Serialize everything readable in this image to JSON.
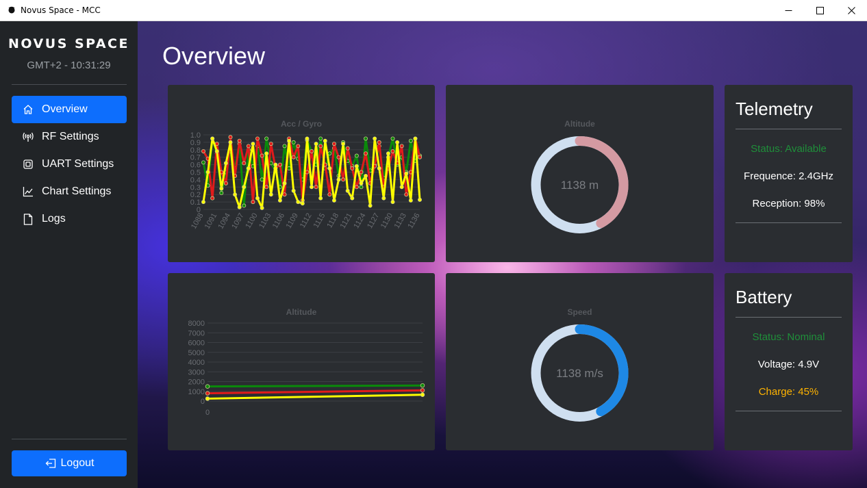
{
  "window": {
    "title": "Novus Space - MCC"
  },
  "sidebar": {
    "brand": "NOVUS SPACE",
    "clock": "GMT+2 - 10:31:29",
    "items": [
      {
        "label": "Overview",
        "icon": "home-icon",
        "active": true
      },
      {
        "label": "RF Settings",
        "icon": "antenna-icon",
        "active": false
      },
      {
        "label": "UART Settings",
        "icon": "chip-icon",
        "active": false
      },
      {
        "label": "Chart Settings",
        "icon": "graph-icon",
        "active": false
      },
      {
        "label": "Logs",
        "icon": "file-icon",
        "active": false
      }
    ],
    "logout_label": "Logout"
  },
  "main": {
    "title": "Overview"
  },
  "telemetry": {
    "heading": "Telemetry",
    "status": "Status: Available",
    "frequence": "Frequence: 2.4GHz",
    "reception": "Reception: 98%"
  },
  "battery": {
    "heading": "Battery",
    "status": "Status: Nominal",
    "voltage": "Voltage: 4.9V",
    "charge": "Charge: 45%"
  },
  "colors": {
    "accent": "#0d6efd",
    "status_ok": "#1f8f3a",
    "warning": "#ffb300",
    "series_green": "#0a8a0a",
    "series_red": "#e01b1b",
    "series_yellow": "#ffff00"
  },
  "chart_data": [
    {
      "type": "line",
      "title": "Acc / Gyro",
      "x_tick_labels": [
        "1088",
        "1091",
        "1094",
        "1097",
        "1100",
        "1103",
        "1106",
        "1109",
        "1112",
        "1115",
        "1118",
        "1121",
        "1124",
        "1127",
        "1130",
        "1133",
        "1136"
      ],
      "ylim": [
        0,
        1
      ],
      "y_ticks": [
        "0",
        "0.1",
        "0.2",
        "0.3",
        "0.4",
        "0.5",
        "0.6",
        "0.7",
        "0.8",
        "0.9",
        "1.0"
      ],
      "series": [
        {
          "color": "#0a8a0a",
          "values": [
            0.63,
            0.32,
            0.95,
            0.75,
            0.22,
            0.5,
            0.78,
            0.55,
            0.88,
            0.05,
            0.8,
            0.58,
            0.85,
            0.4,
            0.95,
            0.62,
            0.52,
            0.3,
            0.85,
            0.55,
            0.9,
            0.68,
            0.4,
            0.93,
            0.78,
            0.6,
            0.95,
            0.55,
            0.75,
            0.82,
            0.45,
            0.9,
            0.65,
            0.58,
            0.72,
            0.3,
            0.95,
            0.52,
            0.6,
            0.85,
            0.42,
            0.7,
            0.95,
            0.6,
            0.7,
            0.5,
            0.92,
            0.65,
            0.72
          ]
        },
        {
          "color": "#e01b1b",
          "values": [
            0.78,
            0.68,
            0.15,
            0.88,
            0.5,
            0.35,
            0.97,
            0.45,
            0.92,
            0.62,
            0.85,
            0.1,
            0.95,
            0.72,
            0.3,
            0.88,
            0.55,
            0.6,
            0.2,
            0.95,
            0.7,
            0.85,
            0.12,
            0.5,
            0.78,
            0.3,
            0.85,
            0.6,
            0.2,
            0.88,
            0.7,
            0.4,
            0.82,
            0.55,
            0.3,
            0.5,
            0.75,
            0.35,
            0.58,
            0.9,
            0.3,
            0.55,
            0.78,
            0.62,
            0.85,
            0.2,
            0.5,
            0.95,
            0.7
          ]
        },
        {
          "color": "#ffff00",
          "values": [
            0.1,
            0.5,
            0.95,
            0.78,
            0.28,
            0.62,
            0.9,
            0.2,
            0.03,
            0.3,
            0.55,
            0.88,
            0.15,
            0.02,
            0.75,
            0.2,
            0.6,
            0.12,
            0.35,
            0.92,
            0.25,
            0.1,
            0.08,
            0.95,
            0.3,
            0.88,
            0.15,
            0.92,
            0.55,
            0.12,
            0.4,
            0.88,
            0.25,
            0.15,
            0.58,
            0.35,
            0.45,
            0.05,
            0.95,
            0.55,
            0.15,
            0.75,
            0.1,
            0.9,
            0.3,
            0.48,
            0.12,
            0.95,
            0.13
          ]
        }
      ]
    },
    {
      "type": "line",
      "title": "Altitude",
      "x_tick_labels": [
        "0"
      ],
      "ylim": [
        0,
        8000
      ],
      "y_ticks": [
        "0",
        "1000",
        "2000",
        "3000",
        "4000",
        "5000",
        "6000",
        "7000",
        "8000"
      ],
      "series": [
        {
          "color": "#0a8a0a",
          "values": [
            1500,
            1600
          ]
        },
        {
          "color": "#e01b1b",
          "values": [
            800,
            1100
          ]
        },
        {
          "color": "#ffff00",
          "values": [
            250,
            650
          ]
        }
      ]
    },
    {
      "type": "doughnut",
      "title": "Altitude",
      "center_label": "1138 m",
      "fraction": 0.42,
      "fill_color": "#d49aa2",
      "track_color": "#cfdff0"
    },
    {
      "type": "doughnut",
      "title": "Speed",
      "center_label": "1138 m/s",
      "fraction": 0.42,
      "fill_color": "#1e88e5",
      "track_color": "#cfdff0"
    }
  ]
}
